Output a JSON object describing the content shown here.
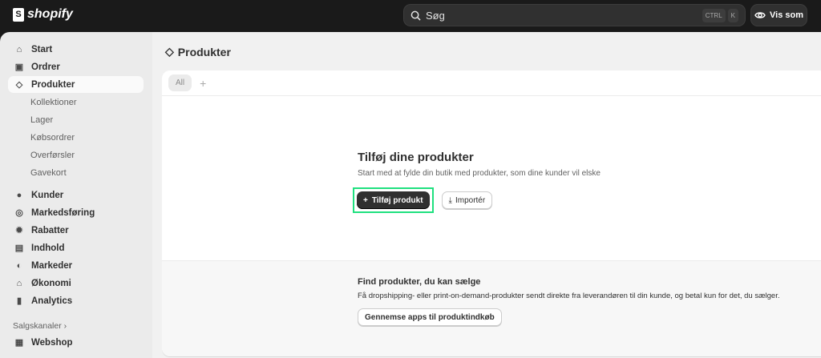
{
  "topbar": {
    "brand": "shopify",
    "search_placeholder": "Søg",
    "shortcut": [
      "CTRL",
      "K"
    ],
    "view_as": "Vis som"
  },
  "sidebar": {
    "items": [
      {
        "label": "Start",
        "icon": "home-icon"
      },
      {
        "label": "Ordrer",
        "icon": "inbox-icon"
      },
      {
        "label": "Produkter",
        "icon": "tag-icon",
        "active": true
      }
    ],
    "sub_items": [
      "Kollektioner",
      "Lager",
      "Købsordrer",
      "Overførsler",
      "Gavekort"
    ],
    "items2": [
      {
        "label": "Kunder",
        "icon": "person-icon"
      },
      {
        "label": "Markedsføring",
        "icon": "target-icon"
      },
      {
        "label": "Rabatter",
        "icon": "discount-icon"
      },
      {
        "label": "Indhold",
        "icon": "content-icon"
      },
      {
        "label": "Markeder",
        "icon": "globe-icon"
      },
      {
        "label": "Økonomi",
        "icon": "bank-icon"
      },
      {
        "label": "Analytics",
        "icon": "chart-icon"
      }
    ],
    "sales_channels": "Salgskanaler",
    "webshop": "Webshop"
  },
  "main": {
    "title": "Produkter",
    "tabs": [
      "All"
    ],
    "empty": {
      "heading": "Tilføj dine produkter",
      "text": "Start med at fylde din butik med produkter, som dine kunder vil elske",
      "add_button": "Tilføj produkt",
      "import_button": "Importér"
    },
    "find": {
      "heading": "Find produkter, du kan sælge",
      "text": "Få dropshipping- eller print-on-demand-produkter sendt direkte fra leverandøren til din kunde, og betal kun for det, du sælger.",
      "button": "Gennemse apps til produktindkøb"
    }
  },
  "colors": {
    "highlight": "#1fe07f",
    "topbar": "#1a1a1a"
  }
}
